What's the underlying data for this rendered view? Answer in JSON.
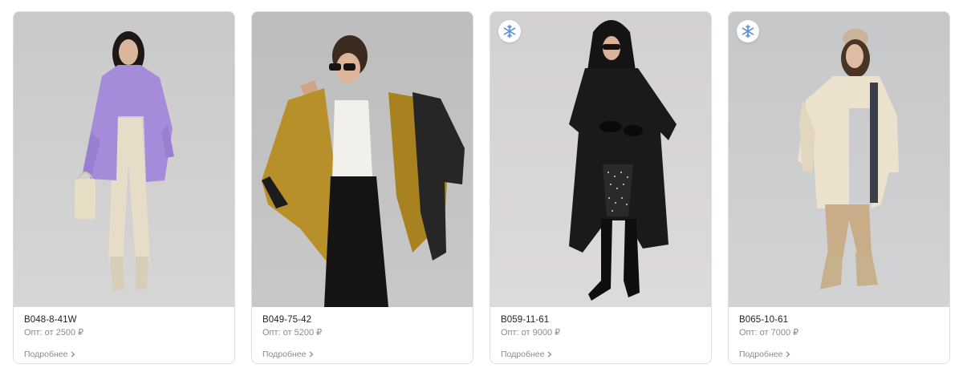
{
  "products": [
    {
      "sku": "B048-8-41W",
      "price_label": "Опт: от 2500 ₽",
      "more_label": "Подробнее",
      "has_winter_badge": false,
      "photo_icon": "model-photo-lilac-coat"
    },
    {
      "sku": "B049-75-42",
      "price_label": "Опт: от 5200 ₽",
      "more_label": "Подробнее",
      "has_winter_badge": false,
      "photo_icon": "model-photo-bomber-jacket"
    },
    {
      "sku": "B059-11-61",
      "price_label": "Опт: от 9000 ₽",
      "more_label": "Подробнее",
      "has_winter_badge": true,
      "badge_icon": "snowflake-icon",
      "photo_icon": "model-photo-black-down-coat"
    },
    {
      "sku": "B065-10-61",
      "price_label": "Опт: от 7000 ₽",
      "more_label": "Подробнее",
      "has_winter_badge": true,
      "badge_icon": "snowflake-icon",
      "photo_icon": "model-photo-beige-down-coat"
    }
  ],
  "colors": {
    "badge_snowflake": "#5b8fd4",
    "card_border": "#dedede",
    "muted_text": "#8a8a8a"
  }
}
